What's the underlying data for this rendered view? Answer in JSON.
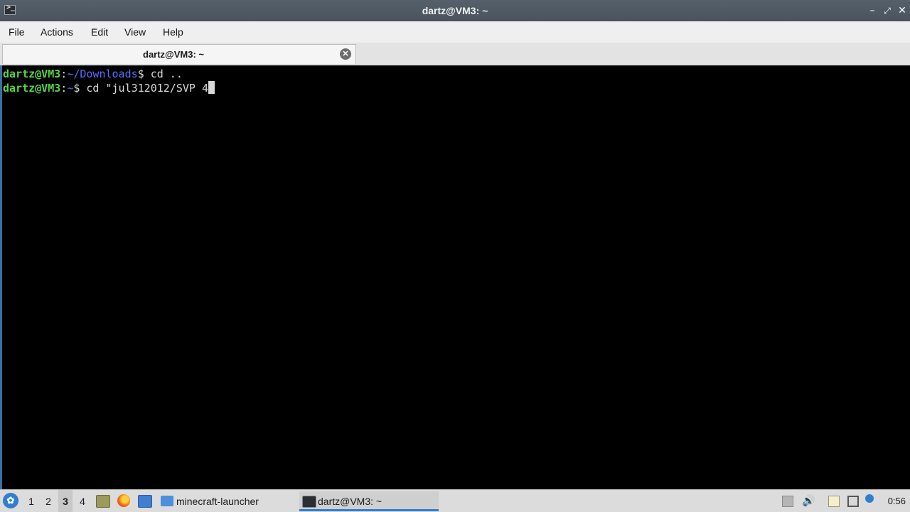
{
  "window": {
    "title": "dartz@VM3: ~",
    "app_icon_glyph": ">_",
    "minimize": "–",
    "maximize": "⤢",
    "close": "✕"
  },
  "menubar": {
    "items": [
      "File",
      "Actions",
      "Edit",
      "View",
      "Help"
    ]
  },
  "tabs": [
    {
      "label": "dartz@VM3: ~",
      "close_glyph": "✕"
    }
  ],
  "terminal": {
    "lines": [
      {
        "user": "dartz@VM3",
        "sep": ":",
        "path": "~/Downloads",
        "prompt": "$ ",
        "command": "cd .."
      },
      {
        "user": "dartz@VM3",
        "sep": ":",
        "path": "~",
        "prompt": "$ ",
        "command": "cd \"jul312012/SVP 4"
      }
    ],
    "colors": {
      "user": "#55d445",
      "path": "#5c6cff",
      "text": "#d8d8d8"
    }
  },
  "taskbar": {
    "start_glyph": "✿",
    "workspaces": [
      "1",
      "2",
      "3",
      "4"
    ],
    "active_workspace": "3",
    "quicklaunch": [
      "file-manager-icon",
      "firefox-icon",
      "desktop-icon"
    ],
    "tasks": [
      {
        "label": "minecraft-launcher",
        "icon": "folder-icon"
      },
      {
        "label": "dartz@VM3: ~",
        "icon": "terminal-icon",
        "active": true
      }
    ],
    "tray": [
      "notification-icon",
      "volume-icon",
      "clipboard-icon",
      "network-icon",
      "update-icon"
    ],
    "clock": "0:56"
  }
}
